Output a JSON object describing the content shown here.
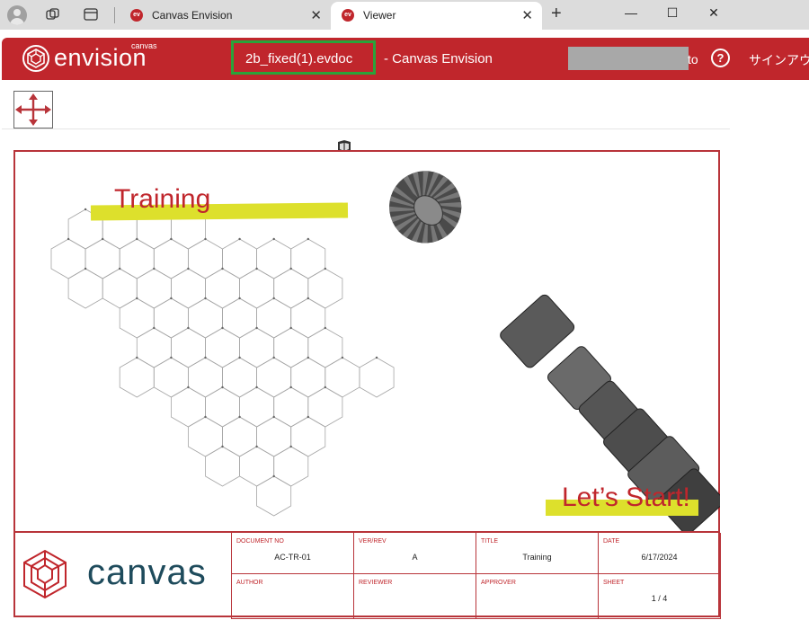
{
  "browser": {
    "tabs": [
      {
        "title": "Canvas Envision",
        "badge": "ev",
        "close": "✕"
      },
      {
        "title": "Viewer",
        "badge": "ev",
        "close": "✕"
      }
    ],
    "new_tab": "+",
    "window_controls": {
      "minimize": "—",
      "maximize": "☐",
      "close": "✕"
    }
  },
  "header": {
    "logo_small": "canvas",
    "logo_text": "envision",
    "document_name": "2b_fixed(1).evdoc",
    "app_suffix": "- Canvas Envision",
    "user_visible_tail": "to",
    "help_label": "?",
    "signout_label": "サインアウト"
  },
  "viewer": {
    "fit_icon": "fit-to-view-icon"
  },
  "sheet": {
    "training_text": "Training",
    "start_text": "Let’s Start!",
    "brand_text": "canvas",
    "title_block": {
      "document_no_label": "DOCUMENT NO",
      "document_no": "AC-TR-01",
      "ver_rev_label": "VER/REV",
      "ver_rev": "A",
      "title_label": "TITLE",
      "title": "Training",
      "date_label": "DATE",
      "date": "6/17/2024",
      "author_label": "AUTHOR",
      "author": "",
      "reviewer_label": "REVIEWER",
      "reviewer": "",
      "approver_label": "APPROVER",
      "approver": "",
      "sheet_label": "SHEET",
      "sheet": "1 / 4"
    }
  },
  "colors": {
    "brand_red": "#c0262c",
    "highlight_yellow": "#dde02c",
    "frame_green": "#2aa33a",
    "brand_navy": "#1e4b5c"
  }
}
